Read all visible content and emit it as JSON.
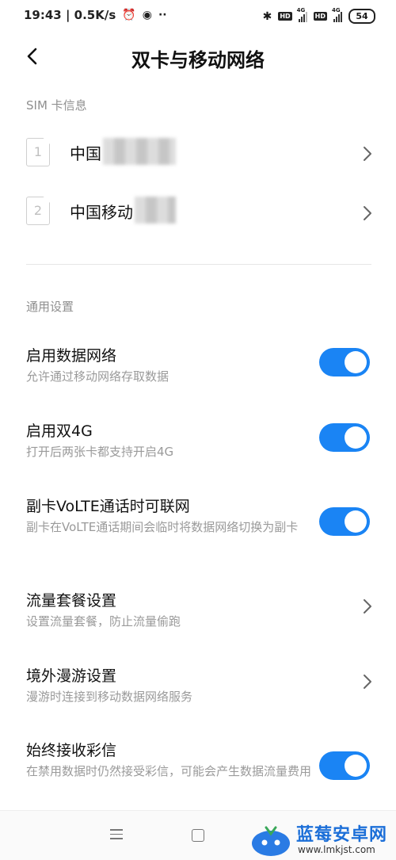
{
  "status_bar": {
    "time_speed": "19:43 | 0.5K/s",
    "alarm_icon": "alarm-icon",
    "app_icon": "globe-icon",
    "more": "··",
    "sim1_network": "4G",
    "sim2_network": "4G",
    "hd": "HD",
    "battery": "54"
  },
  "header": {
    "title": "双卡与移动网络"
  },
  "sim_section": {
    "label": "SIM 卡信息",
    "cards": [
      {
        "slot": "1",
        "name": "中国"
      },
      {
        "slot": "2",
        "name": "中国移动"
      }
    ]
  },
  "general": {
    "label": "通用设置",
    "items": [
      {
        "title": "启用数据网络",
        "subtitle": "允许通过移动网络存取数据",
        "control": "toggle",
        "on": true
      },
      {
        "title": "启用双4G",
        "subtitle": "打开后两张卡都支持开启4G",
        "control": "toggle",
        "on": true
      },
      {
        "title": "副卡VoLTE通话时可联网",
        "subtitle": "副卡在VoLTE通话期间会临时将数据网络切换为副卡",
        "control": "toggle",
        "on": true
      },
      {
        "title": "流量套餐设置",
        "subtitle": "设置流量套餐，防止流量偷跑",
        "control": "chevron"
      },
      {
        "title": "境外漫游设置",
        "subtitle": "漫游时连接到移动数据网络服务",
        "control": "chevron"
      },
      {
        "title": "始终接收彩信",
        "subtitle": "在禁用数据时仍然接受彩信，可能会产生数据流量费用",
        "control": "toggle",
        "on": true
      }
    ]
  },
  "colors": {
    "accent": "#1a84f4",
    "secondary_text": "#9a9a9a",
    "section_label": "#8f8f8f"
  },
  "watermark": {
    "brand": "蓝莓安卓网",
    "url": "www.lmkjst.com"
  }
}
